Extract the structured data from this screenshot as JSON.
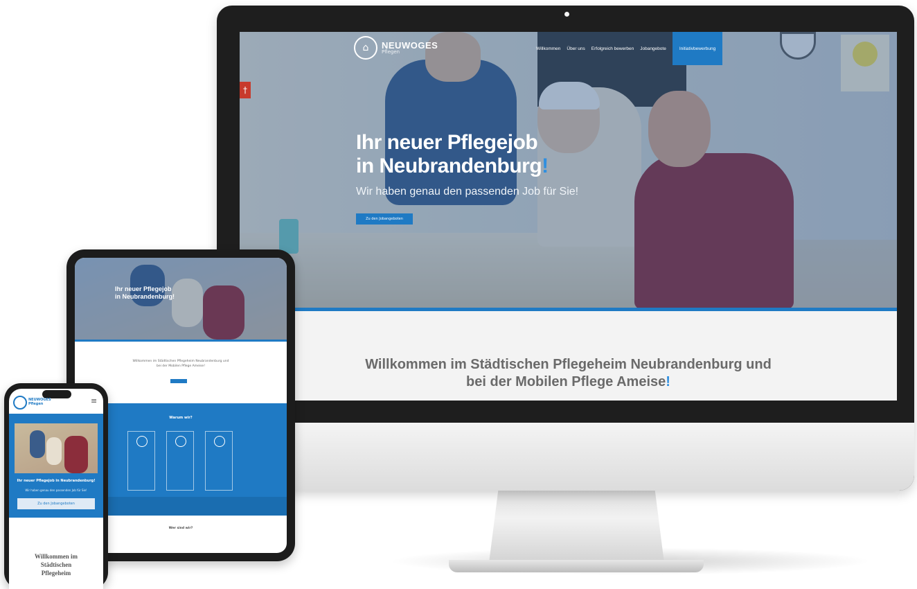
{
  "desktop": {
    "logo": {
      "name": "NEUWOGES",
      "tagline": "Pflegen"
    },
    "nav": {
      "items": [
        "Willkommen",
        "Über uns",
        "Erfolgreich bewerben",
        "Jobangebote"
      ],
      "cta": "Initiativbewerbung"
    },
    "hero": {
      "title_line1": "Ihr neuer Pflegejob",
      "title_line2": "in Neubrandenburg",
      "title_accent": "!",
      "subtitle": "Wir haben genau den passenden Job für Sie!",
      "button": "Zu den Jobangeboten"
    },
    "welcome": {
      "line1": "Willkommen im Städtischen Pflegeheim Neubrandenburg und",
      "line2": "bei der Mobilen Pflege Ameise",
      "accent": "!"
    }
  },
  "tablet": {
    "hero_title_line1": "Ihr neuer Pflegejob",
    "hero_title_line2": "in Neubrandenburg!",
    "welcome_line1": "Willkommen im Städtischen Pflegeheim Neubrandenburg und",
    "welcome_line2": "bei der Mobilen Pflege Ameise!",
    "section_title": "Warum wir?",
    "bottom_title": "Wer sind wir?"
  },
  "phone": {
    "logo_text_line1": "NEUWOGES",
    "logo_text_line2": "Pflegen",
    "menu_icon": "≡",
    "hero_title": "Ihr neuer Pflegejob in Neubrandenburg!",
    "hero_sub": "Wir haben genau den passenden Job für Sie!",
    "button": "Zu den Jobangeboten",
    "welcome_line1": "Willkommen im",
    "welcome_line2": "Städtischen",
    "welcome_line3": "Pflegeheim"
  },
  "colors": {
    "accent": "#1f7ac4",
    "heading_gray": "#6a6a6a",
    "brand_red": "#8b2d3b"
  },
  "icons": [
    "logo-icon",
    "flag-icon",
    "hamburger-menu-icon"
  ]
}
